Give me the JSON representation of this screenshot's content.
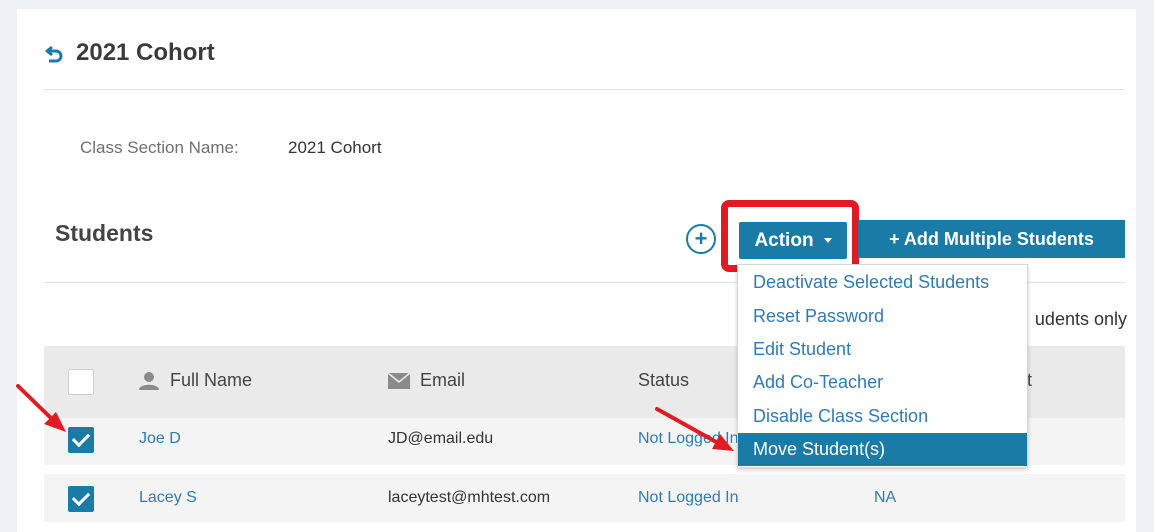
{
  "page": {
    "title": "2021 Cohort"
  },
  "details": {
    "section_label": "Class Section Name:",
    "section_value": "2021 Cohort"
  },
  "students": {
    "heading": "Students",
    "add_symbol": "+",
    "action_label": "Action",
    "add_multiple_label": "+ Add Multiple Students",
    "filter_text_partial": "udents only"
  },
  "dropdown": {
    "items": [
      "Deactivate Selected Students",
      "Reset Password",
      "Edit Student",
      "Add Co-Teacher",
      "Disable Class Section",
      "Move Student(s)"
    ],
    "active_index": 5
  },
  "table": {
    "headers": {
      "full_name": "Full Name",
      "email": "Email",
      "status": "Status",
      "last_partial": "t"
    },
    "rows": [
      {
        "checked": true,
        "name": "Joe D",
        "email": "JD@email.edu",
        "status": "Not Logged In",
        "last": ""
      },
      {
        "checked": true,
        "name": "Lacey S",
        "email": "laceytest@mhtest.com",
        "status": "Not Logged In",
        "last": "NA"
      }
    ]
  },
  "colors": {
    "brand_blue": "#1a7ba6",
    "link_blue": "#2f7bb6",
    "annotation_red": "#e21b23"
  }
}
